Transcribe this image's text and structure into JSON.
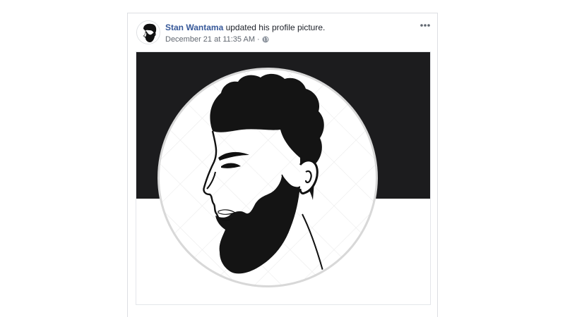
{
  "post": {
    "author_name": "Stan Wantama",
    "action_text": " updated his profile picture.",
    "timestamp": "December 21 at 11:35 AM",
    "separator": "·",
    "privacy_icon": "globe-icon",
    "more_icon": "more-options-icon"
  },
  "colors": {
    "author_link": "#365899",
    "banner": "#1c1c1e",
    "meta_text": "#616770"
  },
  "image": {
    "subject_icon": "bearded-man-profile-illustration"
  }
}
